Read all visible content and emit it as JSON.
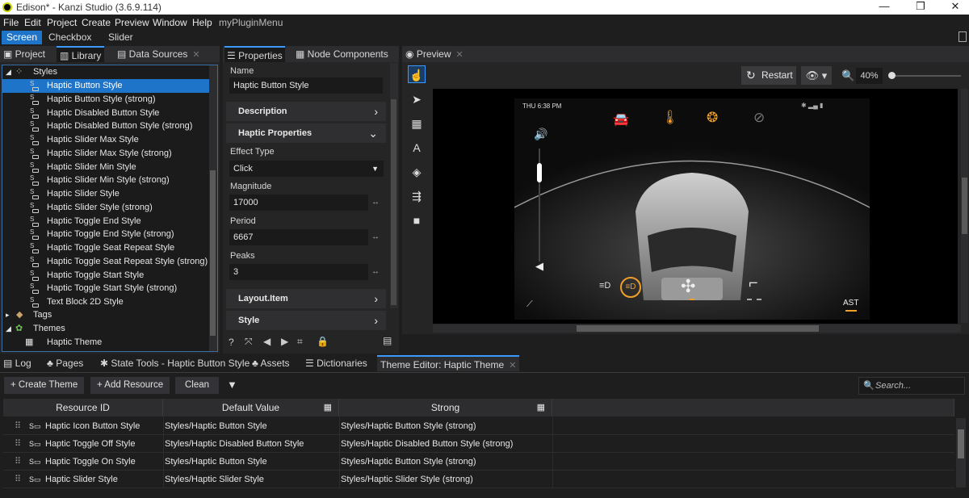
{
  "window": {
    "title": "Edison* - Kanzi Studio (3.6.9.114)",
    "min": "—",
    "max": "❒",
    "close": "✕"
  },
  "menu": [
    "File",
    "Edit",
    "Project",
    "Create",
    "Preview",
    "Window",
    "Help",
    "myPluginMenu"
  ],
  "top_tabs": [
    "Screen",
    "Checkbox",
    "Slider"
  ],
  "left_tabs": [
    "Project",
    "Library",
    "Data Sources"
  ],
  "tree": {
    "styles_label": "Styles",
    "items": [
      "Haptic Button Style",
      "Haptic Button Style (strong)",
      "Haptic Disabled Button Style",
      "Haptic Disabled Button Style (strong)",
      "Haptic Slider Max Style",
      "Haptic Slider Max Style (strong)",
      "Haptic Slider Min Style",
      "Haptic Slider Min Style (strong)",
      "Haptic Slider Style",
      "Haptic Slider Style (strong)",
      "Haptic Toggle End Style",
      "Haptic Toggle End Style (strong)",
      "Haptic Toggle Seat Repeat Style",
      "Haptic Toggle Seat Repeat Style (strong)",
      "Haptic Toggle Start Style",
      "Haptic Toggle Start Style (strong)",
      "Text Block 2D Style"
    ],
    "tags_label": "Tags",
    "themes_label": "Themes",
    "theme_item": "Haptic Theme"
  },
  "props_tabs": [
    "Properties",
    "Node Components"
  ],
  "props": {
    "name_label": "Name",
    "name_value": "Haptic Button Style",
    "description": "Description",
    "haptic_properties": "Haptic Properties",
    "effect_type_label": "Effect Type",
    "effect_type_value": "Click",
    "magnitude_label": "Magnitude",
    "magnitude_value": "17000",
    "period_label": "Period",
    "period_value": "6667",
    "peaks_label": "Peaks",
    "peaks_value": "3",
    "layout_item": "Layout.Item",
    "style": "Style"
  },
  "preview": {
    "tab": "Preview",
    "restart": "Restart",
    "zoom": "40%",
    "zoom_level": 0.4
  },
  "device": {
    "time": "THU 6:38 PM",
    "ast": "AST",
    "volume_level": 0.8
  },
  "bottom_tabs": [
    "Log",
    "Pages",
    "State Tools - Haptic Button Style",
    "Assets",
    "Dictionaries",
    "Theme Editor: Haptic Theme"
  ],
  "bottom_toolbar": {
    "create_theme": "Create Theme",
    "add_resource": "Add Resource",
    "clean": "Clean",
    "search_placeholder": "Search..."
  },
  "table": {
    "headers": [
      "Resource ID",
      "Default Value",
      "Strong"
    ],
    "rows": [
      [
        "Haptic Icon Button Style",
        "Styles/Haptic Button Style",
        "Styles/Haptic Button Style (strong)"
      ],
      [
        "Haptic Toggle Off Style",
        "Styles/Haptic Disabled Button Style",
        "Styles/Haptic Disabled Button Style (strong)"
      ],
      [
        "Haptic Toggle On Style",
        "Styles/Haptic Button Style",
        "Styles/Haptic Button Style (strong)"
      ],
      [
        "Haptic Slider Style",
        "Styles/Haptic Slider Style",
        "Styles/Haptic Slider Style (strong)"
      ]
    ]
  },
  "colors": {
    "accent": "#1e74c8",
    "orange": "#f0a02a",
    "bg": "#1e1e1e"
  }
}
